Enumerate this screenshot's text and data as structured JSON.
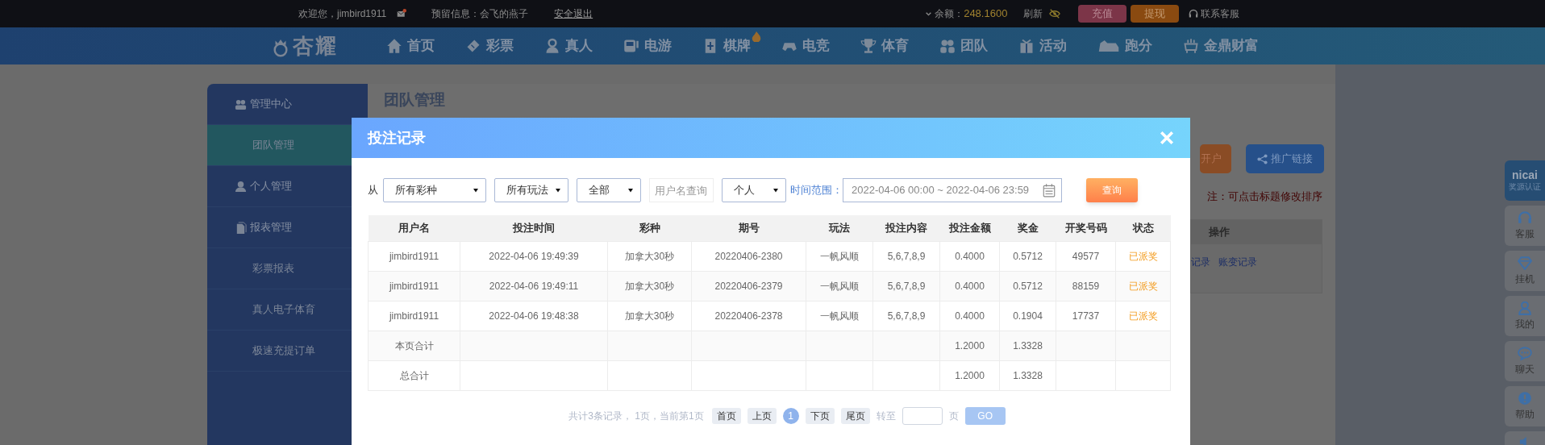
{
  "top_bar": {
    "welcome": "欢迎您，jimbird1911",
    "message": "预留信息：会飞的燕子",
    "logout": "安全退出",
    "balance_label": "余额：",
    "balance": "248.1600",
    "refresh": "刷新",
    "deposit": "充值",
    "withdraw": "提现",
    "support": "联系客服"
  },
  "nav": {
    "logo": "杏耀",
    "items": [
      {
        "label": "首页"
      },
      {
        "label": "彩票"
      },
      {
        "label": "真人"
      },
      {
        "label": "电游"
      },
      {
        "label": "棋牌"
      },
      {
        "label": "电竞"
      },
      {
        "label": "体育"
      },
      {
        "label": "团队"
      },
      {
        "label": "活动"
      },
      {
        "label": "跑分"
      },
      {
        "label": "金鼎财富"
      }
    ]
  },
  "sidebar": {
    "items": [
      {
        "kind": "group",
        "label": "管理中心",
        "selected": false
      },
      {
        "kind": "link",
        "label": "团队管理",
        "selected": true
      },
      {
        "kind": "group",
        "label": "个人管理",
        "selected": false
      },
      {
        "kind": "group",
        "label": "报表管理",
        "selected": false
      },
      {
        "kind": "link",
        "label": "彩票报表",
        "selected": false
      },
      {
        "kind": "link",
        "label": "真人电子体育",
        "selected": false
      },
      {
        "kind": "link",
        "label": "极速充提订单",
        "selected": false
      }
    ]
  },
  "page": {
    "title": "团队管理",
    "buttons": [
      "开户",
      "推广链接"
    ],
    "note": "注：可点击标题修改排序",
    "table_column": "操作",
    "links": [
      "记录",
      "账变记录"
    ]
  },
  "modal": {
    "title": "投注记录",
    "filters": {
      "from_label": "从",
      "selects": [
        "所有彩种",
        "所有玩法",
        "全部"
      ],
      "username_placeholder": "用户名查询",
      "scope": "个人",
      "range_label": "时间范围：",
      "range": "2022-04-06 00:00 ~ 2022-04-06 23:59",
      "query": "查询"
    },
    "table": {
      "columns": [
        "用户名",
        "投注时间",
        "彩种",
        "期号",
        "玩法",
        "投注内容",
        "投注金额",
        "奖金",
        "开奖号码",
        "状态"
      ],
      "rows": [
        [
          "jimbird1911",
          "2022-04-06 19:49:39",
          "加拿大30秒",
          "20220406-2380",
          "一帆风顺",
          "5,6,7,8,9",
          "0.4000",
          "0.5712",
          "49577",
          "已派奖"
        ],
        [
          "jimbird1911",
          "2022-04-06 19:49:11",
          "加拿大30秒",
          "20220406-2379",
          "一帆风顺",
          "5,6,7,8,9",
          "0.4000",
          "0.5712",
          "88159",
          "已派奖"
        ],
        [
          "jimbird1911",
          "2022-04-06 19:48:38",
          "加拿大30秒",
          "20220406-2378",
          "一帆风顺",
          "5,6,7,8,9",
          "0.4000",
          "0.1904",
          "17737",
          "已派奖"
        ]
      ],
      "totals": [
        {
          "label": "本页合计",
          "amount": "1.2000",
          "prize": "1.3328"
        },
        {
          "label": "总合计",
          "amount": "1.2000",
          "prize": "1.3328"
        }
      ]
    },
    "pagination": {
      "summary": "共计3条记录， 1页，当前第1页",
      "buttons": [
        {
          "label": "首页",
          "kind": "link"
        },
        {
          "label": "上页",
          "kind": "link"
        },
        {
          "label": "1",
          "kind": "page",
          "selected": true
        },
        {
          "label": "下页",
          "kind": "link"
        },
        {
          "label": "尾页",
          "kind": "link"
        }
      ],
      "goto_label": "转至",
      "page_suffix": "页",
      "go": "GO"
    }
  },
  "right_dock": {
    "badge": {
      "logo": "nicai",
      "label": "奖源认证"
    },
    "items": [
      {
        "label": "客服"
      },
      {
        "label": "挂机"
      },
      {
        "label": "我的"
      },
      {
        "label": "聊天"
      },
      {
        "label": "帮助"
      }
    ]
  }
}
